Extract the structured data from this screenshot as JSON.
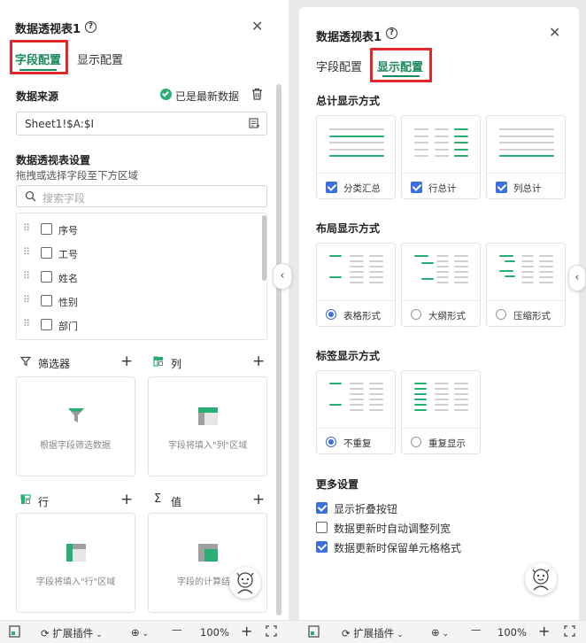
{
  "left": {
    "title": "数据透视表1",
    "tabs": {
      "field": "字段配置",
      "display": "显示配置"
    },
    "source": {
      "label": "数据来源",
      "status": "已是最新数据",
      "value": "Sheet1!$A:$I"
    },
    "pivot_settings": {
      "title": "数据透视表设置",
      "hint": "拖拽或选择字段至下方区域",
      "search_placeholder": "搜索字段"
    },
    "fields": [
      "序号",
      "工号",
      "姓名",
      "性别",
      "部门"
    ],
    "zones": {
      "filter": {
        "label": "筛选器",
        "hint": "根据字段筛选数据"
      },
      "column": {
        "label": "列",
        "hint": "字段将填入\"列\"区域"
      },
      "row": {
        "label": "行",
        "hint": "字段将填入\"行\"区域"
      },
      "value": {
        "label": "值",
        "hint": "字段的计算结"
      }
    }
  },
  "right": {
    "title": "数据透视表1",
    "tabs": {
      "field": "字段配置",
      "display": "显示配置"
    },
    "totals": {
      "title": "总计显示方式",
      "options": [
        {
          "label": "分类汇总",
          "checked": true
        },
        {
          "label": "行总计",
          "checked": true
        },
        {
          "label": "列总计",
          "checked": true
        }
      ]
    },
    "layout": {
      "title": "布局显示方式",
      "options": [
        {
          "label": "表格形式",
          "selected": true
        },
        {
          "label": "大纲形式",
          "selected": false
        },
        {
          "label": "压缩形式",
          "selected": false
        }
      ]
    },
    "labels": {
      "title": "标签显示方式",
      "options": [
        {
          "label": "不重复",
          "selected": true
        },
        {
          "label": "重复显示",
          "selected": false
        }
      ]
    },
    "more": {
      "title": "更多设置",
      "items": [
        {
          "label": "显示折叠按钮",
          "checked": true
        },
        {
          "label": "数据更新时自动调整列宽",
          "checked": false
        },
        {
          "label": "数据更新时保留单元格格式",
          "checked": true
        }
      ]
    }
  },
  "bottom_bar": {
    "plugins": "扩展插件",
    "zoom": "100%",
    "minus": "—",
    "plus": "+"
  },
  "colors": {
    "accent": "#1a8a5c",
    "check": "#3b6fe0",
    "highlight": "#e12828"
  }
}
